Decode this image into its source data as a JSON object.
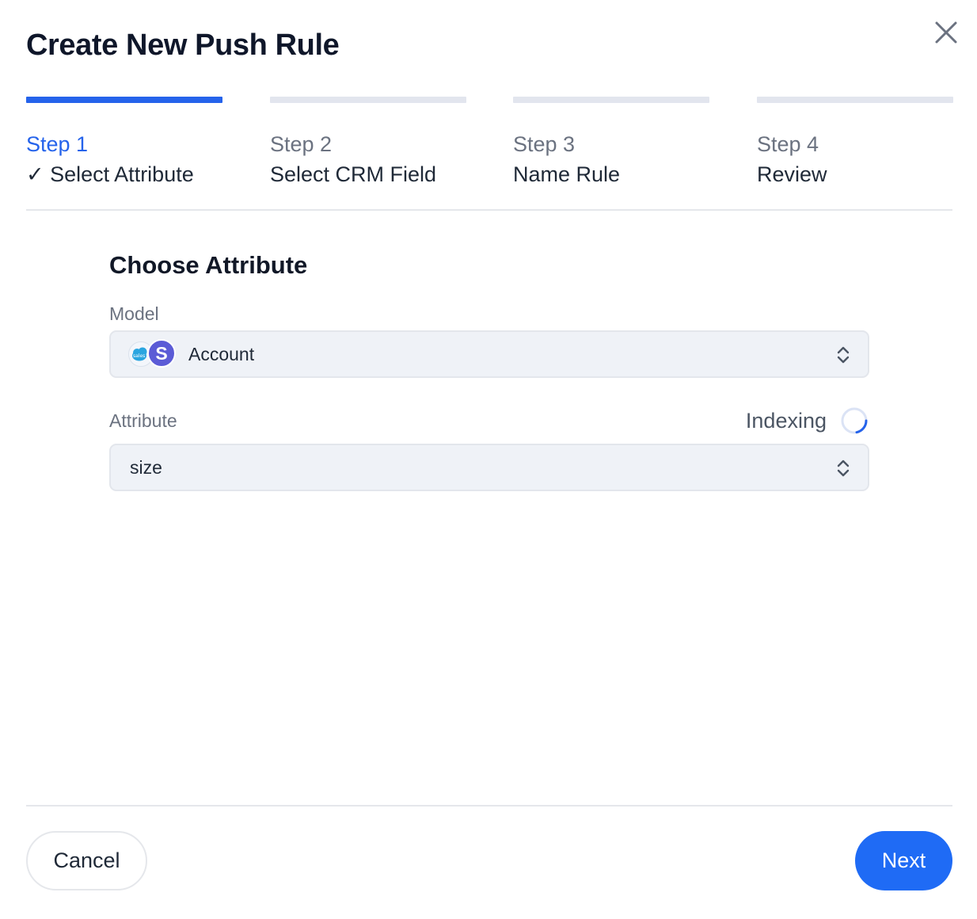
{
  "dialog": {
    "title": "Create New Push Rule"
  },
  "steps": [
    {
      "number": "Step 1",
      "label": "✓ Select Attribute",
      "state": "active"
    },
    {
      "number": "Step 2",
      "label": "Select CRM Field",
      "state": "upcoming"
    },
    {
      "number": "Step 3",
      "label": "Name Rule",
      "state": "upcoming"
    },
    {
      "number": "Step 4",
      "label": "Review",
      "state": "upcoming"
    }
  ],
  "form": {
    "section_title": "Choose Attribute",
    "model": {
      "label": "Model",
      "value": "Account",
      "logo_letter": "S",
      "logo_small_text": "sales"
    },
    "attribute": {
      "label": "Attribute",
      "value": "size",
      "status": "Indexing"
    }
  },
  "footer": {
    "cancel_label": "Cancel",
    "next_label": "Next"
  },
  "colors": {
    "accent": "#2563eb",
    "next_button": "#1f6bf5",
    "inactive_step": "#e2e5ee"
  }
}
